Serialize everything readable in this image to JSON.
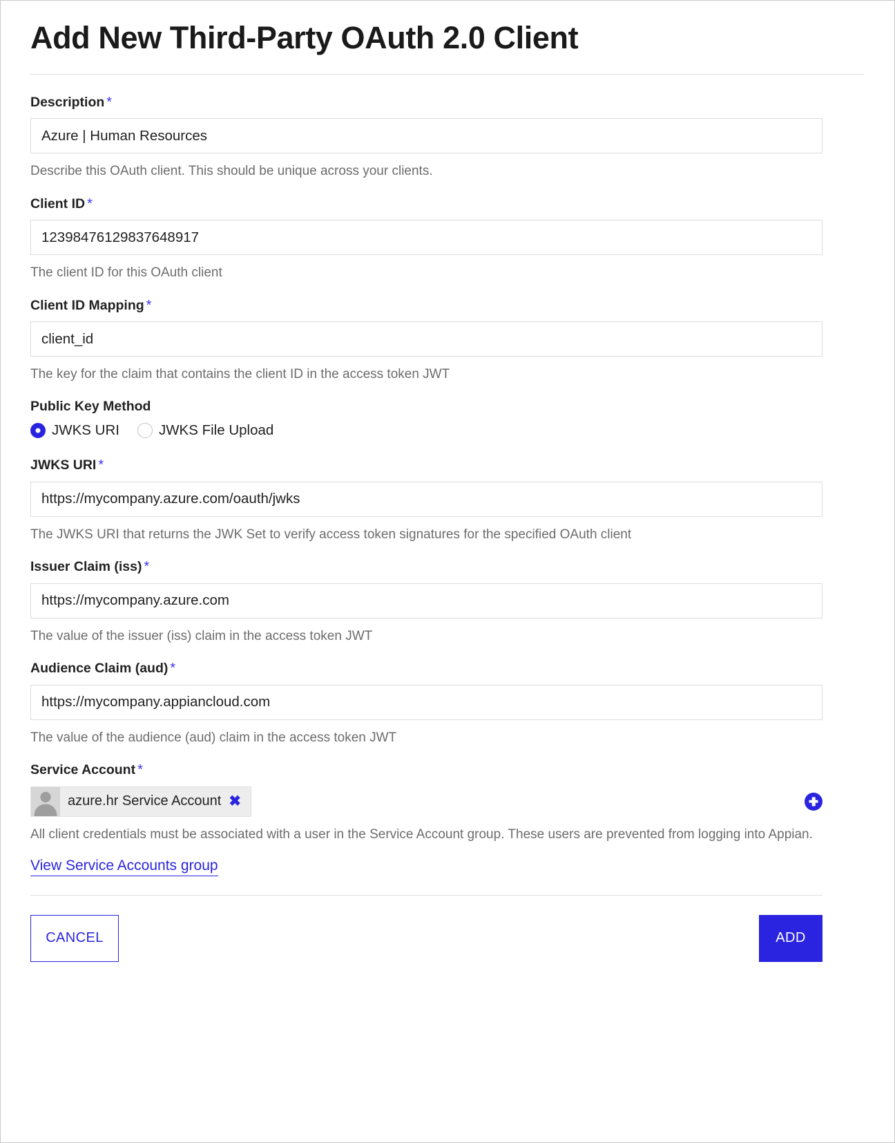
{
  "page": {
    "title": "Add New Third-Party OAuth 2.0 Client",
    "required_marker": "*"
  },
  "fields": {
    "description": {
      "label": "Description",
      "value": "Azure | Human Resources",
      "placeholder": "",
      "helper": "Describe this OAuth client. This should be unique across your clients."
    },
    "client_id": {
      "label": "Client ID",
      "value": "12398476129837648917",
      "placeholder": "",
      "helper": "The client ID for this OAuth client"
    },
    "client_id_mapping": {
      "label": "Client ID Mapping",
      "value": "client_id",
      "placeholder": "",
      "helper": "The key for the claim that contains the client ID in the access token JWT"
    },
    "public_key_method": {
      "label": "Public Key Method",
      "options": [
        {
          "label": "JWKS URI",
          "selected": true
        },
        {
          "label": "JWKS File Upload",
          "selected": false
        }
      ]
    },
    "jwks_uri": {
      "label": "JWKS URI",
      "value": "https://mycompany.azure.com/oauth/jwks",
      "placeholder": "",
      "helper": "The JWKS URI that returns the JWK Set to verify access token signatures for the specified OAuth client"
    },
    "issuer_claim": {
      "label": "Issuer Claim (iss)",
      "value": "https://mycompany.azure.com",
      "placeholder": "",
      "helper": "The value of the issuer (iss) claim in the access token JWT"
    },
    "audience_claim": {
      "label": "Audience Claim (aud)",
      "value": "https://mycompany.appiancloud.com",
      "placeholder": "",
      "helper": "The value of the audience (aud) claim in the access token JWT"
    },
    "service_account": {
      "label": "Service Account",
      "chip_text": "azure.hr Service Account",
      "chip_remove_label": "✖",
      "add_icon": "plus-circle-icon",
      "avatar_icon": "user-avatar-icon",
      "helper": "All client credentials must be associated with a user in the Service Account group. These users are prevented from logging into Appian.",
      "link_text": "View Service Accounts group"
    }
  },
  "footer": {
    "cancel_label": "CANCEL",
    "add_label": "ADD"
  },
  "colors": {
    "accent": "#2a24e0",
    "text": "#1f1f1f",
    "helper_text": "#6c6c6c",
    "border": "#dcdcdc",
    "chip_bg": "#ededed"
  }
}
